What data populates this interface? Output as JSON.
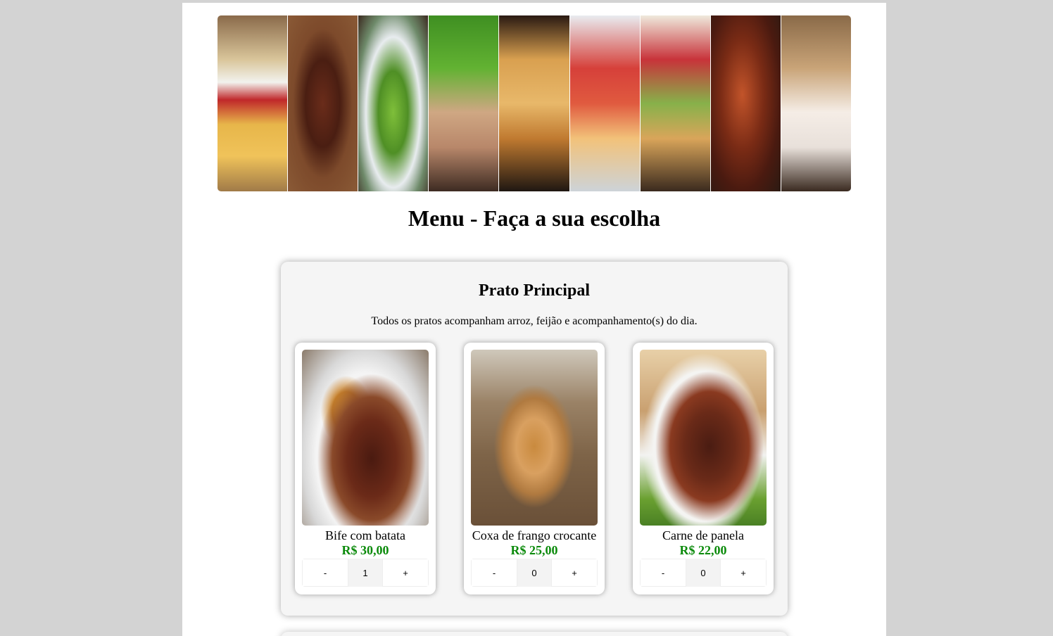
{
  "menu_title": "Menu - Faça a sua escolha",
  "section": {
    "title": "Prato Principal",
    "description": "Todos os pratos acompanham arroz, feijão e acompanhamento(s) do dia.",
    "dishes": [
      {
        "name": "Bife com batata",
        "price": "R$ 30,00",
        "quantity": "1",
        "minus": "-",
        "plus": "+"
      },
      {
        "name": "Coxa de frango crocante",
        "price": "R$ 25,00",
        "quantity": "0",
        "minus": "-",
        "plus": "+"
      },
      {
        "name": "Carne de panela",
        "price": "R$ 22,00",
        "quantity": "0",
        "minus": "-",
        "plus": "+"
      }
    ]
  },
  "colors": {
    "page_background": "#d3d3d3",
    "content_background": "#ffffff",
    "section_background": "#f5f5f5",
    "price_color": "#0a8a0a"
  }
}
